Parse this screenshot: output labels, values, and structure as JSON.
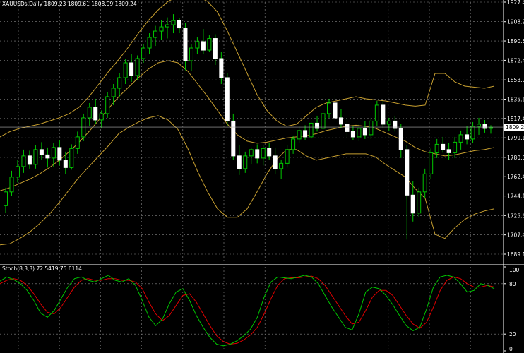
{
  "main_header": "XAUUSDs,Daily 1809.23 1809.61 1808.99 1809.24",
  "sub_header": "Stoch(8,3,3) 72.5419 75.6114",
  "price_axis": [
    "1927.40",
    "1908.90",
    "1890.65",
    "1872.40",
    "1853.90",
    "1835.65",
    "1817.40",
    "1799.15",
    "1780.65",
    "1762.40",
    "1744.15",
    "1725.65",
    "1707.40",
    "1689.15"
  ],
  "current_price": "1809.24",
  "stoch_axis": [
    "100",
    "80",
    "20",
    "0"
  ],
  "colors": {
    "background": "#000000",
    "grid": "#8a8a8a",
    "bull_candle": "#000000",
    "bear_candle": "#ffffff",
    "wick": "#00c800",
    "bollinger": "#c8a030",
    "stoch_main": "#00c800",
    "stoch_signal": "#e00000"
  },
  "chart_data": {
    "type": "candlestick",
    "ylim": [
      1680,
      1930
    ],
    "ohlc": [
      [
        1735,
        1752,
        1728,
        1748
      ],
      [
        1748,
        1768,
        1744,
        1762
      ],
      [
        1762,
        1778,
        1757,
        1772
      ],
      [
        1772,
        1788,
        1766,
        1782
      ],
      [
        1782,
        1787,
        1770,
        1774
      ],
      [
        1774,
        1792,
        1770,
        1788
      ],
      [
        1788,
        1795,
        1778,
        1783
      ],
      [
        1783,
        1790,
        1771,
        1780
      ],
      [
        1780,
        1794,
        1772,
        1790
      ],
      [
        1790,
        1797,
        1773,
        1778
      ],
      [
        1778,
        1786,
        1765,
        1771
      ],
      [
        1771,
        1793,
        1769,
        1789
      ],
      [
        1789,
        1805,
        1784,
        1800
      ],
      [
        1800,
        1822,
        1796,
        1818
      ],
      [
        1818,
        1832,
        1810,
        1828
      ],
      [
        1828,
        1836,
        1812,
        1816
      ],
      [
        1816,
        1825,
        1808,
        1822
      ],
      [
        1822,
        1842,
        1818,
        1838
      ],
      [
        1838,
        1850,
        1830,
        1846
      ],
      [
        1846,
        1860,
        1838,
        1856
      ],
      [
        1856,
        1874,
        1850,
        1870
      ],
      [
        1870,
        1878,
        1852,
        1858
      ],
      [
        1858,
        1877,
        1854,
        1874
      ],
      [
        1874,
        1888,
        1870,
        1884
      ],
      [
        1884,
        1898,
        1878,
        1894
      ],
      [
        1894,
        1905,
        1886,
        1900
      ],
      [
        1900,
        1910,
        1892,
        1904
      ],
      [
        1904,
        1913,
        1893,
        1906
      ],
      [
        1906,
        1916,
        1898,
        1910
      ],
      [
        1910,
        1912,
        1898,
        1903
      ],
      [
        1903,
        1908,
        1863,
        1872
      ],
      [
        1872,
        1888,
        1862,
        1884
      ],
      [
        1884,
        1894,
        1878,
        1890
      ],
      [
        1890,
        1902,
        1878,
        1882
      ],
      [
        1882,
        1896,
        1880,
        1893
      ],
      [
        1893,
        1897,
        1868,
        1874
      ],
      [
        1874,
        1880,
        1850,
        1856
      ],
      [
        1856,
        1860,
        1810,
        1815
      ],
      [
        1815,
        1822,
        1778,
        1782
      ],
      [
        1782,
        1792,
        1764,
        1770
      ],
      [
        1770,
        1786,
        1766,
        1782
      ],
      [
        1782,
        1790,
        1774,
        1788
      ],
      [
        1788,
        1793,
        1775,
        1780
      ],
      [
        1780,
        1792,
        1773,
        1789
      ],
      [
        1789,
        1794,
        1778,
        1782
      ],
      [
        1782,
        1790,
        1765,
        1770
      ],
      [
        1770,
        1778,
        1760,
        1775
      ],
      [
        1775,
        1792,
        1771,
        1788
      ],
      [
        1788,
        1801,
        1784,
        1798
      ],
      [
        1798,
        1810,
        1794,
        1806
      ],
      [
        1806,
        1811,
        1797,
        1800
      ],
      [
        1800,
        1815,
        1798,
        1813
      ],
      [
        1813,
        1820,
        1805,
        1808
      ],
      [
        1808,
        1826,
        1804,
        1822
      ],
      [
        1822,
        1836,
        1818,
        1832
      ],
      [
        1832,
        1840,
        1815,
        1818
      ],
      [
        1818,
        1826,
        1808,
        1812
      ],
      [
        1812,
        1818,
        1800,
        1805
      ],
      [
        1805,
        1810,
        1797,
        1800
      ],
      [
        1800,
        1812,
        1796,
        1808
      ],
      [
        1808,
        1815,
        1798,
        1802
      ],
      [
        1802,
        1818,
        1798,
        1815
      ],
      [
        1815,
        1834,
        1810,
        1830
      ],
      [
        1830,
        1834,
        1808,
        1812
      ],
      [
        1812,
        1818,
        1806,
        1815
      ],
      [
        1815,
        1820,
        1805,
        1808
      ],
      [
        1808,
        1812,
        1780,
        1788
      ],
      [
        1788,
        1792,
        1703,
        1745
      ],
      [
        1745,
        1758,
        1720,
        1728
      ],
      [
        1728,
        1752,
        1724,
        1748
      ],
      [
        1748,
        1770,
        1742,
        1765
      ],
      [
        1765,
        1789,
        1760,
        1785
      ],
      [
        1785,
        1798,
        1780,
        1793
      ],
      [
        1793,
        1800,
        1785,
        1788
      ],
      [
        1788,
        1794,
        1778,
        1785
      ],
      [
        1785,
        1800,
        1780,
        1795
      ],
      [
        1795,
        1806,
        1788,
        1802
      ],
      [
        1802,
        1810,
        1793,
        1798
      ],
      [
        1798,
        1814,
        1794,
        1810
      ],
      [
        1810,
        1818,
        1802,
        1812
      ],
      [
        1812,
        1816,
        1804,
        1808
      ],
      [
        1808,
        1811,
        1803,
        1809
      ]
    ],
    "bollinger": {
      "upper": [
        1800,
        1805,
        1808,
        1810,
        1812,
        1815,
        1818,
        1822,
        1828,
        1838,
        1850,
        1862,
        1873,
        1885,
        1898,
        1910,
        1920,
        1928,
        1933,
        1935,
        1933,
        1928,
        1918,
        1900,
        1880,
        1860,
        1840,
        1825,
        1815,
        1810,
        1812,
        1820,
        1828,
        1832,
        1834,
        1836,
        1838,
        1836,
        1835,
        1834,
        1832,
        1830,
        1829,
        1830,
        1860,
        1860,
        1852,
        1848,
        1847,
        1846,
        1848
      ],
      "middle": [
        1749,
        1752,
        1756,
        1760,
        1765,
        1771,
        1778,
        1786,
        1795,
        1805,
        1816,
        1827,
        1838,
        1847,
        1856,
        1864,
        1870,
        1872,
        1870,
        1862,
        1850,
        1838,
        1825,
        1812,
        1802,
        1796,
        1794,
        1795,
        1797,
        1799,
        1800,
        1801,
        1803,
        1806,
        1808,
        1810,
        1811,
        1810,
        1808,
        1804,
        1800,
        1796,
        1790,
        1786,
        1784,
        1782,
        1783,
        1785,
        1787,
        1788,
        1790
      ],
      "lower": [
        1698,
        1699,
        1704,
        1710,
        1718,
        1727,
        1738,
        1750,
        1762,
        1772,
        1782,
        1792,
        1803,
        1809,
        1814,
        1818,
        1820,
        1816,
        1807,
        1789,
        1767,
        1748,
        1732,
        1724,
        1724,
        1732,
        1748,
        1765,
        1779,
        1788,
        1788,
        1782,
        1778,
        1780,
        1782,
        1784,
        1784,
        1784,
        1781,
        1774,
        1768,
        1762,
        1751,
        1742,
        1708,
        1704,
        1714,
        1722,
        1727,
        1730,
        1732
      ]
    },
    "stochastic": {
      "main": [
        83,
        88,
        85,
        80,
        72,
        60,
        45,
        40,
        48,
        62,
        76,
        86,
        88,
        84,
        82,
        86,
        90,
        84,
        82,
        86,
        78,
        60,
        40,
        30,
        38,
        56,
        70,
        74,
        60,
        42,
        28,
        16,
        8,
        6,
        8,
        12,
        18,
        26,
        40,
        64,
        82,
        88,
        87,
        86,
        88,
        90,
        88,
        80,
        66,
        52,
        40,
        28,
        25,
        44,
        70,
        76,
        74,
        66,
        55,
        42,
        30,
        24,
        28,
        50,
        76,
        88,
        90,
        88,
        80,
        70,
        72,
        80,
        78,
        74
      ],
      "signal": [
        80,
        84,
        86,
        84,
        78,
        68,
        56,
        46,
        44,
        52,
        64,
        76,
        84,
        86,
        84,
        84,
        86,
        86,
        84,
        84,
        82,
        74,
        58,
        44,
        36,
        42,
        54,
        66,
        68,
        58,
        44,
        30,
        18,
        11,
        8,
        9,
        13,
        19,
        28,
        44,
        62,
        78,
        86,
        87,
        87,
        88,
        89,
        86,
        78,
        66,
        54,
        42,
        32,
        34,
        48,
        64,
        72,
        72,
        66,
        54,
        42,
        32,
        27,
        34,
        52,
        72,
        84,
        88,
        86,
        80,
        76,
        76,
        78,
        76
      ]
    }
  }
}
